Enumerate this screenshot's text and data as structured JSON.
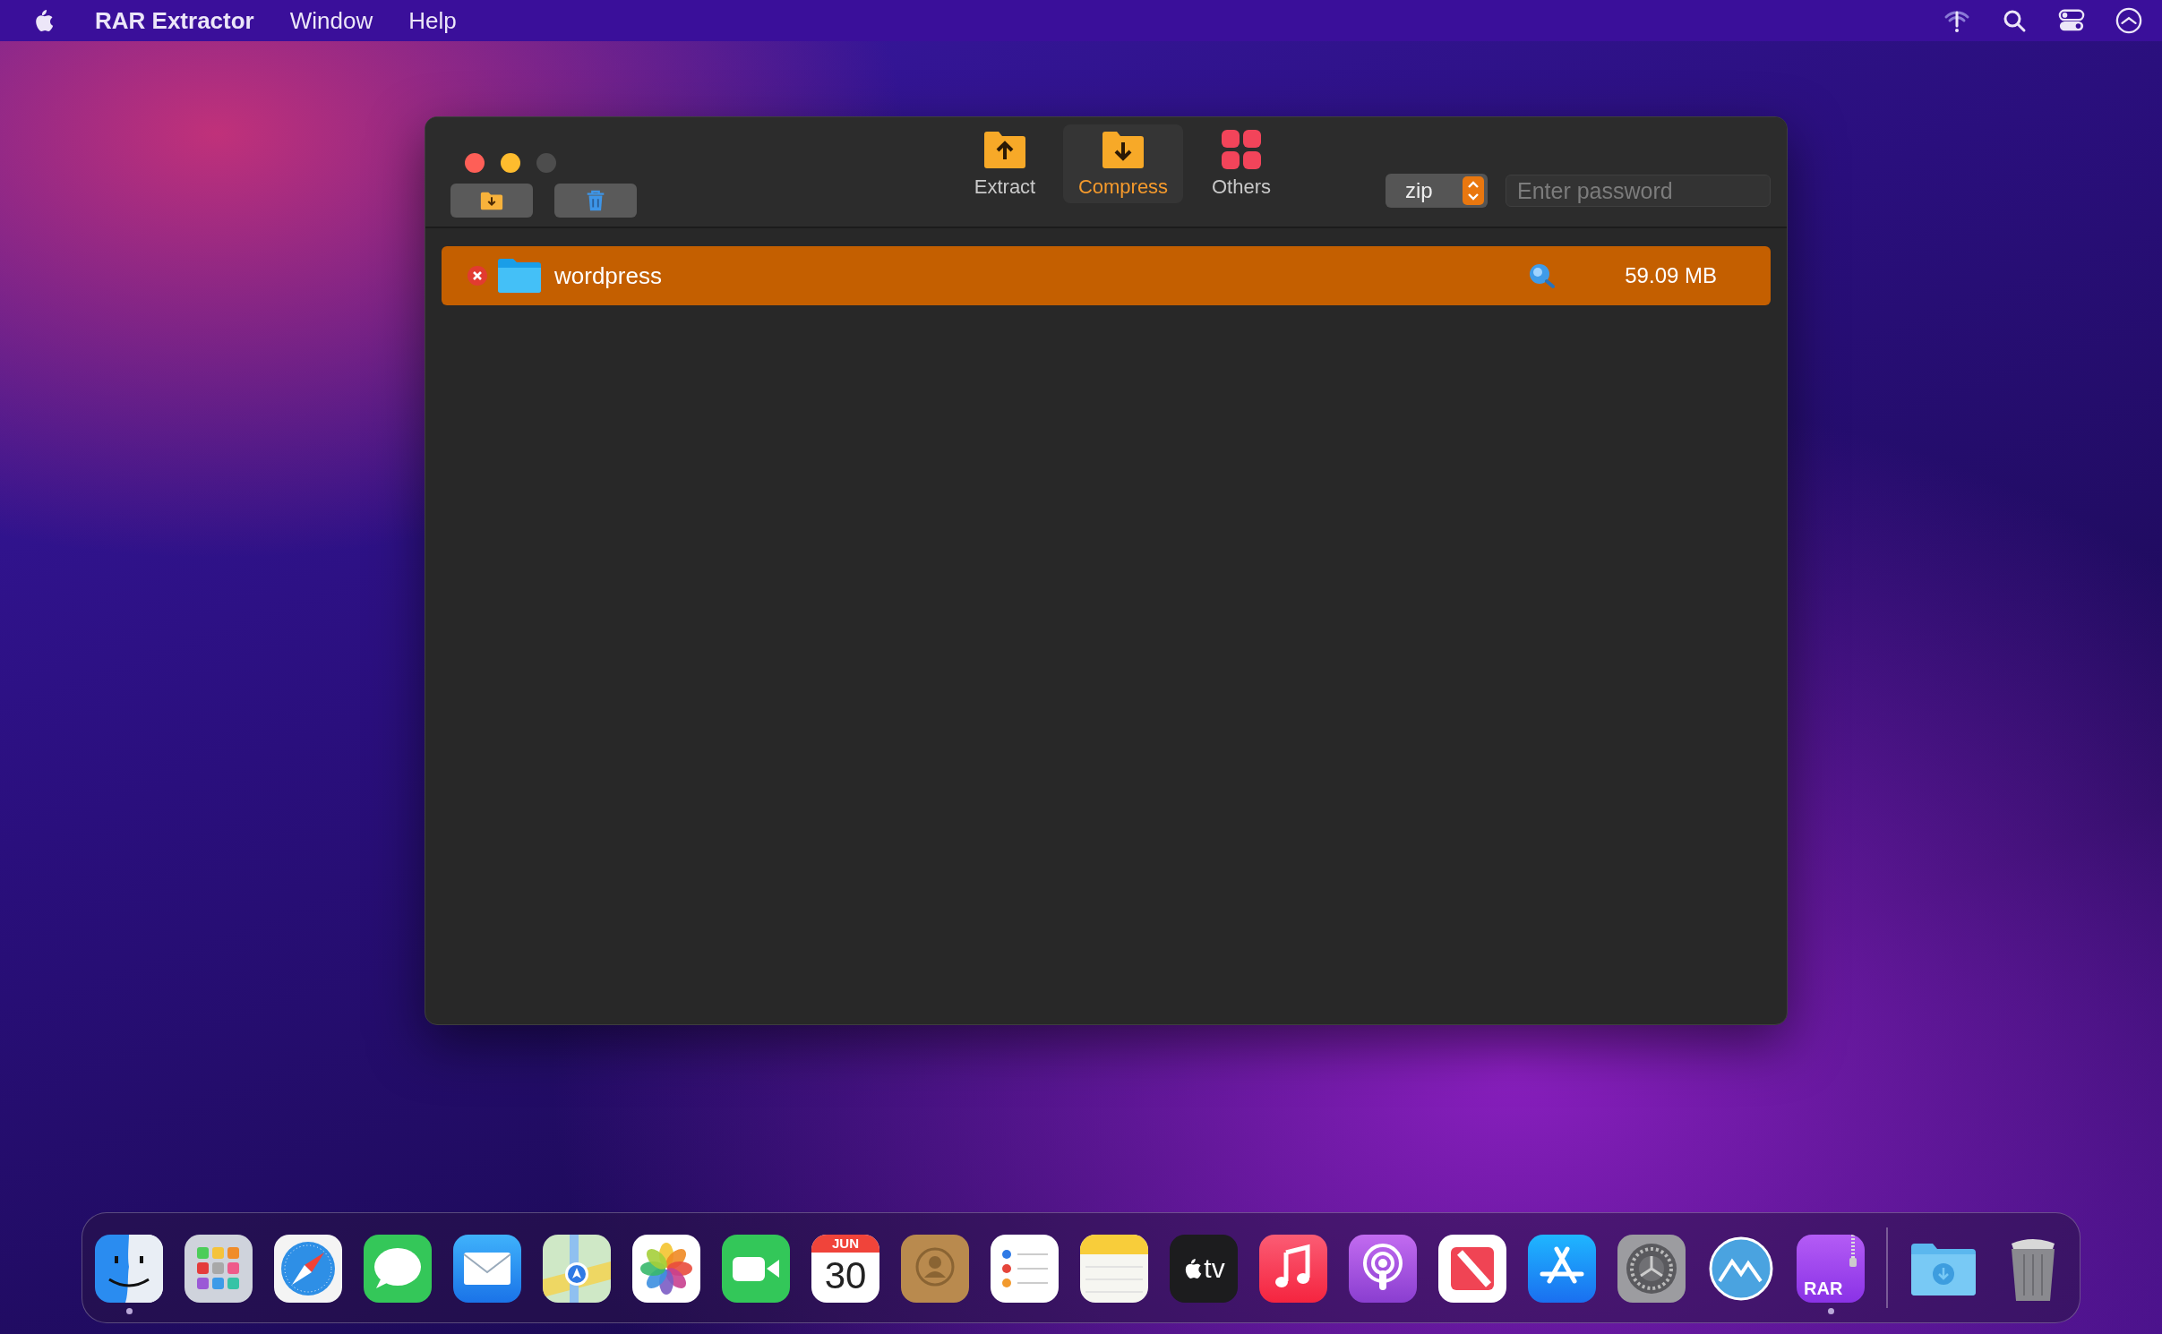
{
  "menu_bar": {
    "app_name": "RAR Extractor",
    "menus": [
      "Window",
      "Help"
    ]
  },
  "window": {
    "tabs": [
      {
        "kind": "extract",
        "label": "Extract",
        "selected": false
      },
      {
        "kind": "compress",
        "label": "Compress",
        "selected": true
      },
      {
        "kind": "others",
        "label": "Others",
        "selected": false
      }
    ],
    "format": {
      "value": "zip"
    },
    "password": {
      "placeholder": "Enter password"
    },
    "files": [
      {
        "name": "wordpress",
        "size": "59.09 MB",
        "selected": true
      }
    ]
  },
  "dock": {
    "apps": [
      {
        "kind": "finder",
        "running": true
      },
      {
        "kind": "launchpad",
        "running": false
      },
      {
        "kind": "safari",
        "running": false
      },
      {
        "kind": "messages",
        "running": false
      },
      {
        "kind": "mail",
        "running": false
      },
      {
        "kind": "maps",
        "running": false
      },
      {
        "kind": "photos",
        "running": false
      },
      {
        "kind": "facetime",
        "running": false
      },
      {
        "kind": "calendar",
        "month": "JUN",
        "day": "30",
        "running": false
      },
      {
        "kind": "contacts",
        "running": false
      },
      {
        "kind": "reminders",
        "running": false
      },
      {
        "kind": "notes",
        "running": false
      },
      {
        "kind": "tv",
        "label": "tv",
        "running": false
      },
      {
        "kind": "music",
        "running": false
      },
      {
        "kind": "podcasts",
        "running": false
      },
      {
        "kind": "news",
        "running": false
      },
      {
        "kind": "appstore",
        "running": false
      },
      {
        "kind": "settings",
        "running": false
      },
      {
        "kind": "mountain",
        "running": false
      },
      {
        "kind": "rar",
        "label": "RAR",
        "running": true
      }
    ],
    "others": [
      {
        "kind": "downloads"
      },
      {
        "kind": "trash"
      }
    ]
  }
}
